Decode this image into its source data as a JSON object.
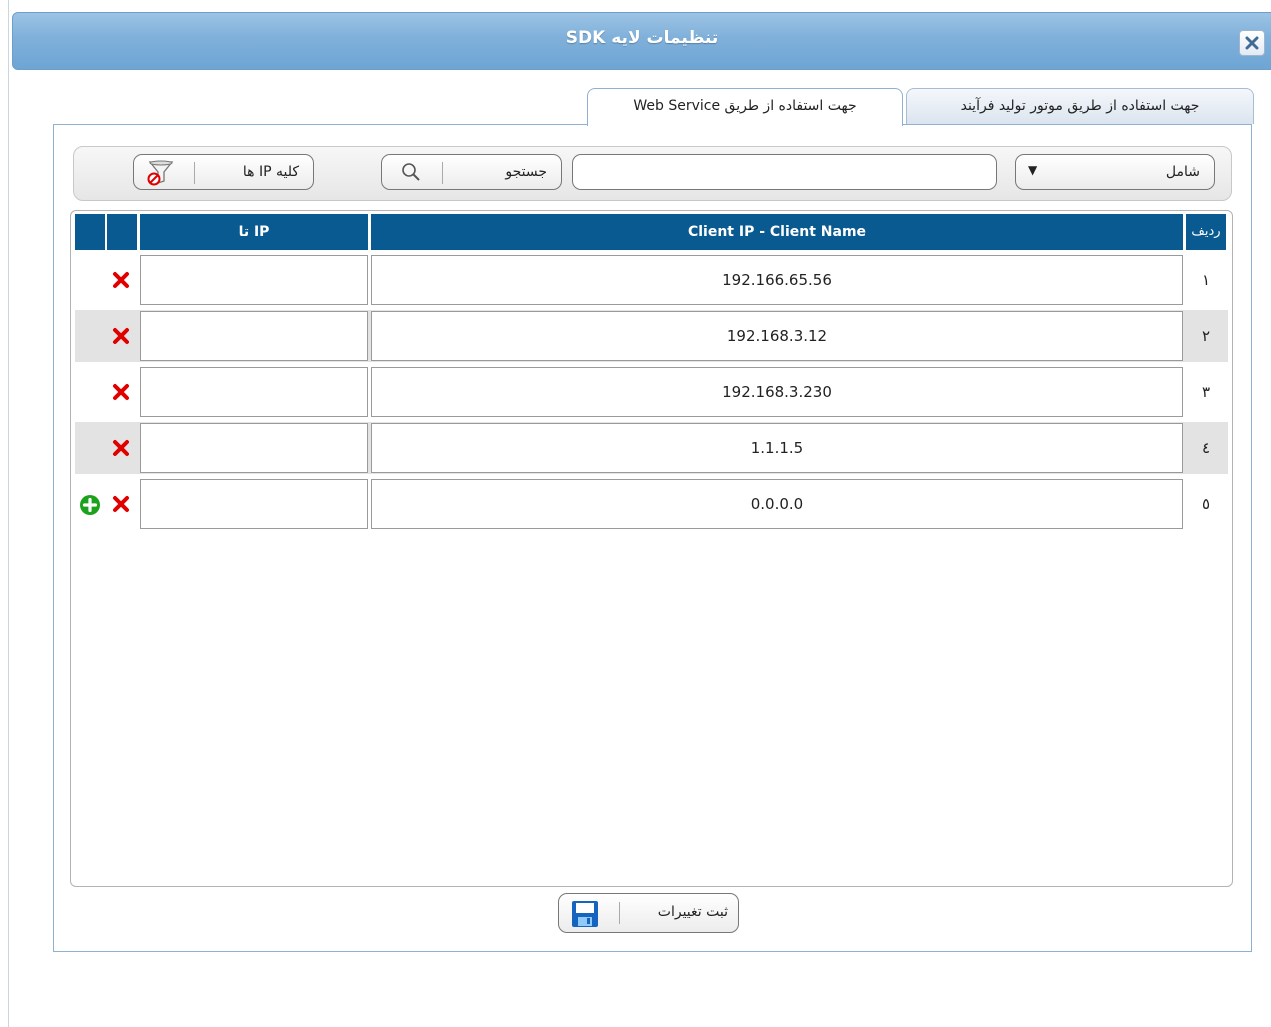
{
  "window": {
    "title": "تنظیمات لایه SDK",
    "close_icon": "close-icon"
  },
  "tabs": [
    {
      "label": "جهت استفاده از طریق موتور تولید فرآیند",
      "active": false
    },
    {
      "label": "جهت استفاده از طریق Web Service",
      "active": true
    }
  ],
  "toolbar": {
    "match_mode": "شامل",
    "search_value": "",
    "search_label": "جستجو",
    "all_ips_label": "کلیه IP ها"
  },
  "grid": {
    "columns": {
      "row": "ردیف",
      "client": "Client IP - Client Name",
      "to_ip": "تا IP"
    },
    "rows": [
      {
        "num": "١",
        "client": "192.166.65.56",
        "to_ip": ""
      },
      {
        "num": "٢",
        "client": "192.168.3.12",
        "to_ip": ""
      },
      {
        "num": "٣",
        "client": "192.168.3.230",
        "to_ip": ""
      },
      {
        "num": "٤",
        "client": "1.1.1.5",
        "to_ip": ""
      },
      {
        "num": "٥",
        "client": "0.0.0.0",
        "to_ip": ""
      }
    ]
  },
  "footer": {
    "save_label": "ثبت تغییرات"
  },
  "colors": {
    "header_bg": "#0a5a92",
    "title_bg": "#7fb0da",
    "delete": "#e00000",
    "add": "#1aa21a"
  }
}
